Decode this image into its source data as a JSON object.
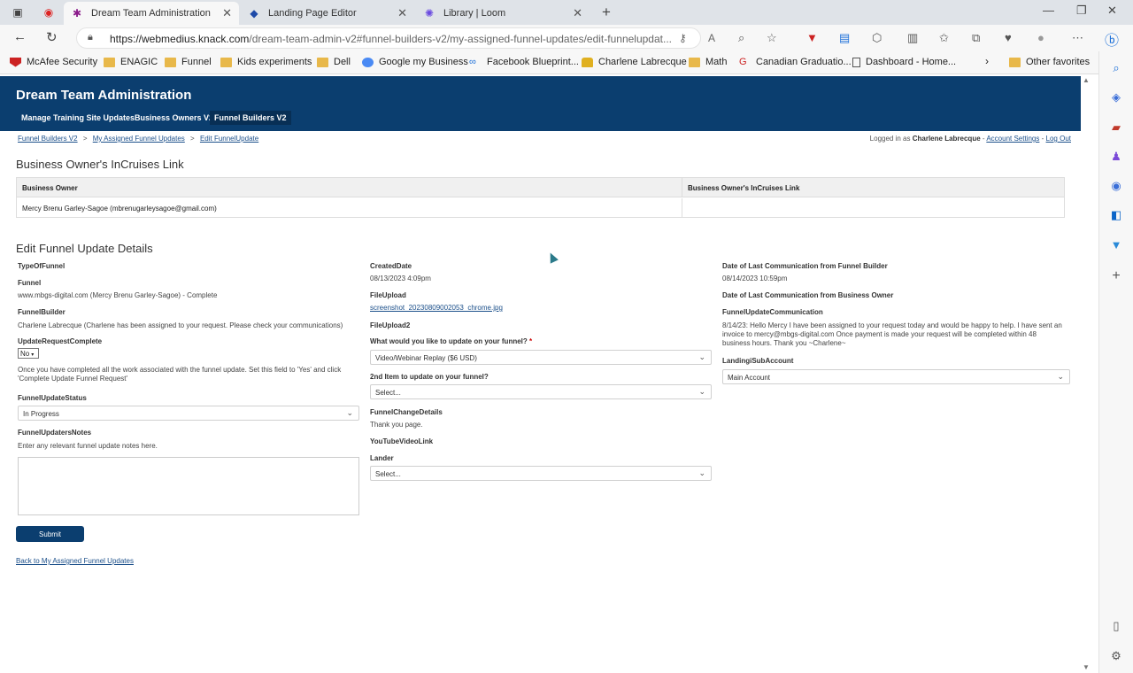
{
  "browser": {
    "tabs": [
      {
        "title": "Dream Team Administration",
        "active": true,
        "icon": "knack-icon"
      },
      {
        "title": "Landing Page Editor",
        "active": false,
        "icon": "landingi-icon"
      },
      {
        "title": "Library | Loom",
        "active": false,
        "icon": "loom-icon"
      }
    ],
    "url_host": "https://webmedius.knack.com",
    "url_path": "/dream-team-admin-v2#funnel-builders-v2/my-assigned-funnel-updates/edit-funnelupdat...",
    "bookmarks": [
      "McAfee Security",
      "ENAGIC",
      "Funnel",
      "Kids experiments",
      "Dell",
      "Google my Business",
      "Facebook Blueprint...",
      "Charlene Labrecque",
      "Math",
      "Canadian Graduatio...",
      "Dashboard - Home..."
    ],
    "other_favorites": "Other favorites"
  },
  "header": {
    "title": "Dream Team Administration",
    "nav": [
      "Manage Training Site Updates",
      "Business Owners V2",
      "Funnel Builders V2"
    ]
  },
  "breadcrumb": {
    "items": [
      "Funnel Builders V2",
      "My Assigned Funnel Updates",
      "Edit FunnelUpdate"
    ],
    "separator": ">"
  },
  "login": {
    "prefix": "Logged in as",
    "user": "Charlene Labrecque",
    "account_settings": "Account Settings",
    "logout": "Log Out",
    "sep": "-"
  },
  "incruises": {
    "title": "Business Owner's InCruises Link",
    "col1": "Business Owner",
    "col2": "Business Owner's InCruises Link",
    "owner": "Mercy Brenu Garley-Sagoe (mbrenugarleysagoe@gmail.com)",
    "link": ""
  },
  "edit": {
    "title": "Edit Funnel Update Details",
    "left": {
      "type_label": "TypeOfFunnel",
      "funnel_label": "Funnel",
      "funnel_value": "www.mbgs-digital.com (Mercy Brenu Garley-Sagoe) - Complete",
      "builder_label": "FunnelBuilder",
      "builder_value": "Charlene Labrecque (Charlene has been assigned to your request. Please check your communications)",
      "complete_label": "UpdateRequestComplete",
      "complete_value": "No",
      "complete_help": "Once you have completed all the work associated with the funnel update. Set this field to 'Yes' and click 'Complete Update Funnel Request'",
      "status_label": "FunnelUpdateStatus",
      "status_value": "In Progress",
      "notes_label": "FunnelUpdatersNotes",
      "notes_help": "Enter any relevant funnel update notes here.",
      "submit": "Submit",
      "back": "Back to My Assigned Funnel Updates"
    },
    "middle": {
      "created_label": "CreatedDate",
      "created_value": "08/13/2023 4:09pm",
      "upload_label": "FileUpload",
      "upload_value": "screenshot_20230809002053_chrome.jpg",
      "upload2_label": "FileUpload2",
      "update_label": "What would you like to update on your funnel?",
      "required": "*",
      "update_value": "Video/Webinar Replay ($6 USD)",
      "second_label": "2nd Item to update on your funnel?",
      "second_value": "Select...",
      "change_label": "FunnelChangeDetails",
      "change_value": "Thank you page.",
      "youtube_label": "YouTubeVideoLink",
      "lander_label": "Lander",
      "lander_value": "Select..."
    },
    "right": {
      "last_fb_label": "Date of Last Communication from Funnel Builder",
      "last_fb_value": "08/14/2023 10:59pm",
      "last_bo_label": "Date of Last Communication from Business Owner",
      "comm_label": "FunnelUpdateCommunication",
      "comm_value": "8/14/23: Hello Mercy I have been assigned to your request today and would be happy to help. I have sent an invoice to mercy@mbgs-digital.com Once payment is made your request will be completed within 48 business hours. Thank you ~Charlene~",
      "sub_label": "LandingiSubAccount",
      "sub_value": "Main Account"
    }
  }
}
